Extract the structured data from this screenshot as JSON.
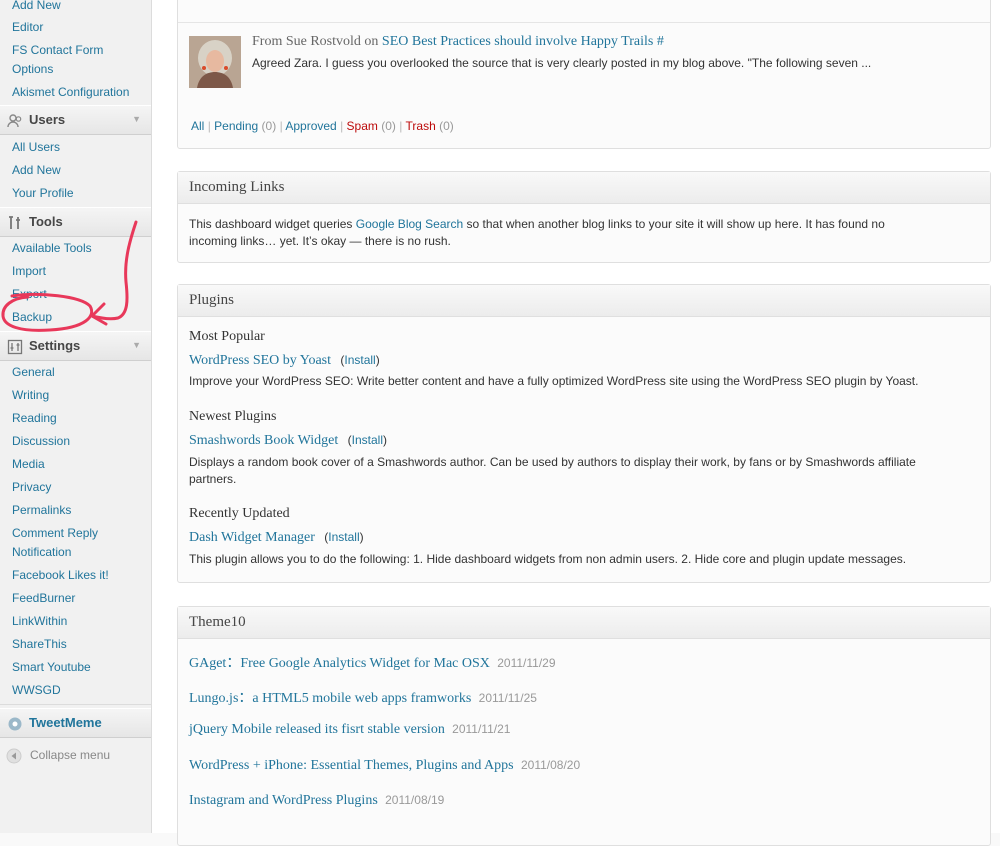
{
  "sidebar": {
    "pages_links": [
      "Add New",
      "Editor",
      "FS Contact Form",
      "Options",
      "Akismet Configuration"
    ],
    "users": {
      "title": "Users",
      "items": [
        "All Users",
        "Add New",
        "Your Profile"
      ]
    },
    "tools": {
      "title": "Tools",
      "items": [
        "Available Tools",
        "Import",
        "Export",
        "Backup"
      ]
    },
    "settings": {
      "title": "Settings",
      "items": [
        "General",
        "Writing",
        "Reading",
        "Discussion",
        "Media",
        "Privacy",
        "Permalinks",
        "Comment Reply",
        "Notification",
        "Facebook Likes it!",
        "FeedBurner",
        "LinkWithin",
        "ShareThis",
        "Smart Youtube",
        "WWSGD"
      ]
    },
    "tweetmeme": "TweetMeme",
    "collapse": "Collapse menu"
  },
  "comments": {
    "from_prefix": "From Sue Rostvold on",
    "post_link": "SEO Best Practices should involve Happy Trails",
    "hash": "#",
    "excerpt": "Agreed Zara. I guess you overlooked the source that is very clearly posted in my blog above. \"The following seven ...",
    "filters": {
      "all": "All",
      "pending": "Pending",
      "pending_count": "(0)",
      "approved": "Approved",
      "spam": "Spam",
      "spam_count": "(0)",
      "trash": "Trash",
      "trash_count": "(0)",
      "sep": "|"
    }
  },
  "incoming_links": {
    "title": "Incoming Links",
    "text_before": "This dashboard widget queries",
    "link": "Google Blog Search",
    "text_after": "so that when another blog links to your site it will show up here. It has found no",
    "text_line2": "incoming links… yet. It’s okay — there is no rush."
  },
  "plugins": {
    "title": "Plugins",
    "install": "Install",
    "sections": [
      {
        "heading": "Most Popular",
        "name": "WordPress SEO by Yoast",
        "desc": "Improve your WordPress SEO: Write better content and have a fully optimized WordPress site using the WordPress SEO plugin by Yoast."
      },
      {
        "heading": "Newest Plugins",
        "name": "Smashwords Book Widget",
        "desc": "Displays a random book cover of a Smashwords author. Can be used by authors to display their work, by fans or by Smashwords affiliate",
        "desc2": "partners."
      },
      {
        "heading": "Recently Updated",
        "name": "Dash Widget Manager",
        "desc": "This plugin allows you to do the following: 1. Hide dashboard widgets from non admin users. 2. Hide core and plugin update messages."
      }
    ]
  },
  "theme10": {
    "title": "Theme10",
    "items": [
      {
        "title": "GAget：Free Google Analytics Widget for Mac OSX",
        "date": "2011/11/29"
      },
      {
        "title": "Lungo.js：a HTML5 mobile web apps framworks",
        "date": "2011/11/25"
      },
      {
        "title": "jQuery Mobile released its fisrt stable version",
        "date": "2011/11/21"
      },
      {
        "title": "WordPress + iPhone: Essential Themes, Plugins and Apps",
        "date": "2011/08/20"
      },
      {
        "title": "Instagram and WordPress Plugins",
        "date": "2011/08/19"
      }
    ]
  },
  "colors": {
    "link": "#21759b",
    "spam": "#bc0b0b",
    "annotation": "#e8385a"
  }
}
